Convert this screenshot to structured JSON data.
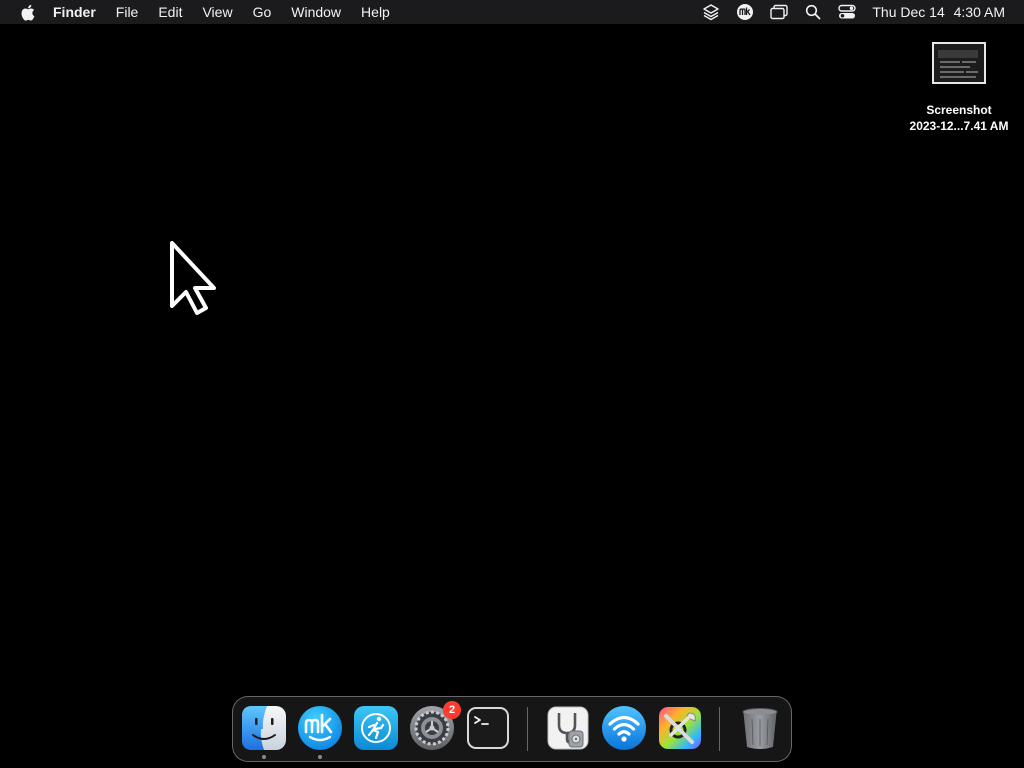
{
  "menubar": {
    "app_name": "Finder",
    "items": [
      "File",
      "Edit",
      "View",
      "Go",
      "Window",
      "Help"
    ],
    "clock": {
      "date": "Thu Dec 14",
      "time": "4:30 AM"
    },
    "status_icons": [
      "layers-icon",
      "mk-icon",
      "screen-mirroring-icon",
      "search-icon",
      "control-center-icon"
    ]
  },
  "desktop": {
    "files": [
      {
        "name_line1": "Screenshot",
        "name_line2": "2023-12...7.41 AM",
        "icon": "screenshot-thumbnail-icon"
      }
    ]
  },
  "dock": {
    "apps": [
      {
        "name": "Finder",
        "icon": "finder-icon",
        "running": true
      },
      {
        "name": "MacKeeper",
        "icon": "mackeeper-icon",
        "running": true
      },
      {
        "name": "Activity",
        "icon": "running-figure-icon",
        "running": false
      },
      {
        "name": "System Settings",
        "icon": "system-settings-icon",
        "running": false,
        "badge": "2"
      },
      {
        "name": "Terminal",
        "icon": "terminal-icon",
        "running": false
      }
    ],
    "others": [
      {
        "name": "Disk Utility",
        "icon": "disk-utility-icon"
      },
      {
        "name": "Wireless Diagnostics",
        "icon": "wifi-icon"
      },
      {
        "name": "ColorSync Utility",
        "icon": "colorsync-utility-icon"
      }
    ],
    "trash": {
      "name": "Trash",
      "icon": "trash-icon"
    }
  },
  "colors": {
    "menubar_bg": "#1b1b1d",
    "desktop_bg": "#000000",
    "badge": "#ff3b30"
  }
}
